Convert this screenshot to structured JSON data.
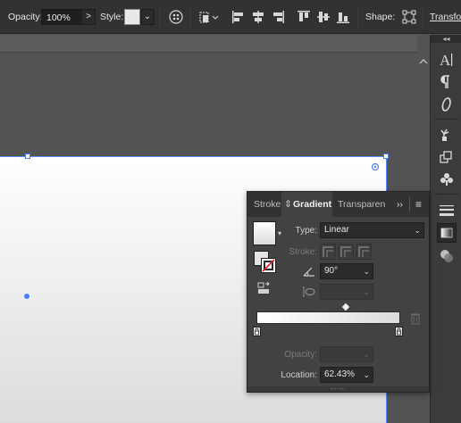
{
  "toolbar": {
    "opacity_label": "Opacity:",
    "opacity_value": "100%",
    "opacity_arrow": ">",
    "style_label": "Style:",
    "style_caret": "⌄",
    "shape_label": "Shape:",
    "transform_label": "Transform"
  },
  "dock": {
    "collapse_glyph": "◂◂",
    "icons": [
      "character-icon",
      "paragraph-icon",
      "opentype-icon",
      "brushes-icon",
      "graphic-styles-icon",
      "symbols-icon",
      "stroke-panel-icon",
      "gradient-panel-icon",
      "transparency-panel-icon"
    ]
  },
  "gradient_panel": {
    "tabs": [
      "Stroke",
      "Gradient",
      "Transparen"
    ],
    "active_tab": "Gradient",
    "tab_sort_glyph": "⇕",
    "more_glyph": "››",
    "menu_glyph": "≡",
    "type_label": "Type:",
    "type_value": "Linear",
    "stroke_label": "Stroke:",
    "angle_value": "90°",
    "opacity_label": "Opacity:",
    "location_label": "Location:",
    "location_value": "62.43%",
    "caret": "⌄"
  },
  "colors": {
    "selection_blue": "#4a7dff",
    "panel_bg": "#424242",
    "app_bg": "#323232"
  }
}
